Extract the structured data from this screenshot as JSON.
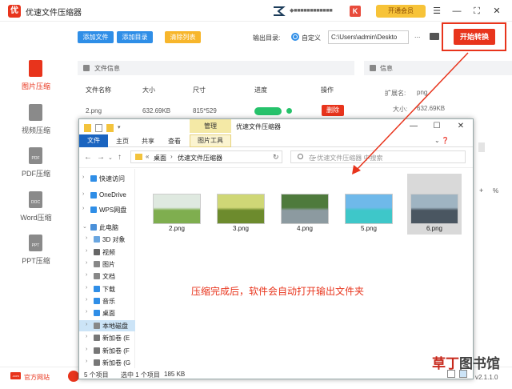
{
  "app": {
    "title": "优速文件压缩器",
    "logo_letter": "优",
    "user_name": "◆■■■■■■■■■■■■",
    "vip_button": "开通会员",
    "window_controls": [
      "☰",
      "—",
      "⛶",
      "✕"
    ]
  },
  "toolbar": {
    "add_file": "添加文件",
    "add_dir": "添加目录",
    "clear_list": "清除列表",
    "output_label": "输出目录:",
    "radio_label": "自定义",
    "output_path": "C:\\Users\\admin\\Deskto",
    "more": "...",
    "start": "开始转换"
  },
  "sidebar": {
    "items": [
      {
        "label": "图片压缩",
        "icon": "image-file-icon",
        "active": true
      },
      {
        "label": "视频压缩",
        "icon": "video-file-icon",
        "active": false
      },
      {
        "label": "PDF压缩",
        "icon": "pdf-file-icon",
        "icon_text": "PDF",
        "active": false
      },
      {
        "label": "Word压缩",
        "icon": "doc-file-icon",
        "icon_text": "DOC",
        "active": false
      },
      {
        "label": "PPT压缩",
        "icon": "ppt-file-icon",
        "icon_text": "PPT",
        "active": false
      }
    ]
  },
  "file_info": {
    "title": "文件信息",
    "columns": [
      "文件名称",
      "大小",
      "尺寸",
      "进度",
      "操作"
    ],
    "row": {
      "name": "2.png",
      "size": "632.69KB",
      "dims": "815*529",
      "progress": 1.0,
      "action": "删除"
    }
  },
  "info_panel": {
    "title": "信息",
    "ext_label": "扩展名:",
    "ext_value": "png",
    "size_label": "大小:",
    "size_value": "632.69KB",
    "percent_sign": "%"
  },
  "bottom": {
    "site_icon_text": ".com",
    "site_link": "官方网站",
    "version": "v2.1.1.0"
  },
  "explorer": {
    "manage_tab": "管理",
    "title": "优速文件压缩器",
    "controls": [
      "—",
      "☐",
      "✕"
    ],
    "tabs": [
      "文件",
      "主页",
      "共享",
      "查看"
    ],
    "picture_tools": "图片工具",
    "address": {
      "prefix": "«",
      "crumb1": "桌面",
      "crumb2": "优速文件压缩器"
    },
    "search_placeholder": "在 优速文件压缩器 中搜索",
    "nav": [
      {
        "label": "快速访问",
        "icon": "star-icon",
        "color": "#2f8ee7",
        "indent": 0
      },
      {
        "label": "OneDrive",
        "icon": "cloud-icon",
        "color": "#2f8ee7",
        "indent": 0
      },
      {
        "label": "WPS网盘",
        "icon": "cloud-icon",
        "color": "#2f8ee7",
        "indent": 0
      },
      {
        "label": "此电脑",
        "icon": "computer-icon",
        "color": "#4a90d9",
        "indent": 0
      },
      {
        "label": "3D 对象",
        "icon": "cube-icon",
        "color": "#6aa6e0",
        "indent": 1
      },
      {
        "label": "视频",
        "icon": "video-icon",
        "color": "#666",
        "indent": 1
      },
      {
        "label": "图片",
        "icon": "picture-icon",
        "color": "#888",
        "indent": 1
      },
      {
        "label": "文档",
        "icon": "document-icon",
        "color": "#888",
        "indent": 1
      },
      {
        "label": "下载",
        "icon": "download-icon",
        "color": "#2f8ee7",
        "indent": 1
      },
      {
        "label": "音乐",
        "icon": "music-icon",
        "color": "#2f8ee7",
        "indent": 1
      },
      {
        "label": "桌面",
        "icon": "desktop-icon",
        "color": "#2f8ee7",
        "indent": 1
      },
      {
        "label": "本地磁盘",
        "icon": "disk-icon",
        "color": "#888",
        "indent": 1,
        "selected": true
      },
      {
        "label": "新加卷 (E",
        "icon": "disk-icon",
        "color": "#777",
        "indent": 1
      },
      {
        "label": "新加卷 (F",
        "icon": "disk-icon",
        "color": "#777",
        "indent": 1
      },
      {
        "label": "新加卷 (G",
        "icon": "disk-icon",
        "color": "#777",
        "indent": 1
      }
    ],
    "files": [
      {
        "name": "2.png",
        "sky": "#dfe9e0",
        "ground": "#7fae4f"
      },
      {
        "name": "3.png",
        "sky": "#cfd776",
        "ground": "#6d8b2d"
      },
      {
        "name": "4.png",
        "sky": "#4e7a3c",
        "ground": "#8c9aa0"
      },
      {
        "name": "5.png",
        "sky": "#6fb9ea",
        "ground": "#3ec7c9"
      },
      {
        "name": "6.png",
        "sky": "#9fb4c2",
        "ground": "#4a5661"
      }
    ],
    "annotation": "压缩完成后，软件会自动打开输出文件夹",
    "status": {
      "count": "5 个项目",
      "selected": "选中 1 个项目",
      "size": "185 KB"
    }
  },
  "watermark": {
    "a": "草丁",
    "b": "图书馆"
  }
}
